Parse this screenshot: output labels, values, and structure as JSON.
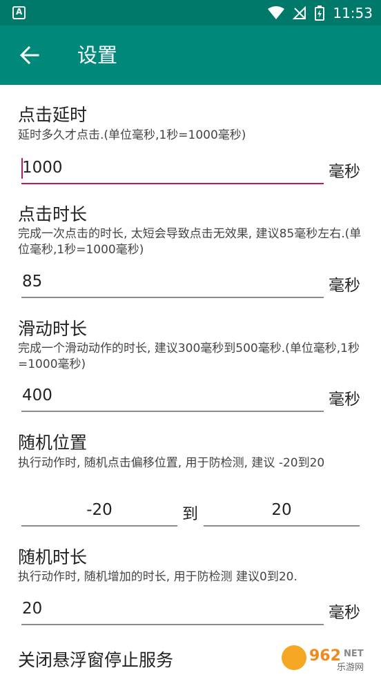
{
  "status_bar": {
    "time": "11:53"
  },
  "app_bar": {
    "title": "设置"
  },
  "settings": {
    "click_delay": {
      "title": "点击延时",
      "desc": "延时多久才点击.(单位毫秒,1秒=1000毫秒)",
      "value": "1000",
      "unit": "毫秒"
    },
    "click_duration": {
      "title": "点击时长",
      "desc": "完成一次点击的时长, 太短会导致点击无效果, 建议85毫秒左右.(单位毫秒,1秒=1000毫秒)",
      "value": "85",
      "unit": "毫秒"
    },
    "swipe_duration": {
      "title": "滑动时长",
      "desc": "完成一个滑动动作的时长, 建议300毫秒到500毫秒.(单位毫秒,1秒=1000毫秒)",
      "value": "400",
      "unit": "毫秒"
    },
    "random_position": {
      "title": "随机位置",
      "desc": "执行动作时, 随机点击偏移位置, 用于防检测, 建议 -20到20",
      "min": "-20",
      "to_label": "到",
      "max": "20"
    },
    "random_duration": {
      "title": "随机时长",
      "desc": "执行动作时, 随机增加的时长, 用于防检测 建议0到20.",
      "value": "20",
      "unit": "毫秒"
    },
    "close_float": {
      "title": "关闭悬浮窗停止服务"
    }
  },
  "watermark": {
    "brand": "962",
    "suffix": "NET",
    "sub": "乐游网"
  },
  "colors": {
    "status_bar": "#00796b",
    "app_bar": "#00897b",
    "accent": "#c2185b"
  }
}
